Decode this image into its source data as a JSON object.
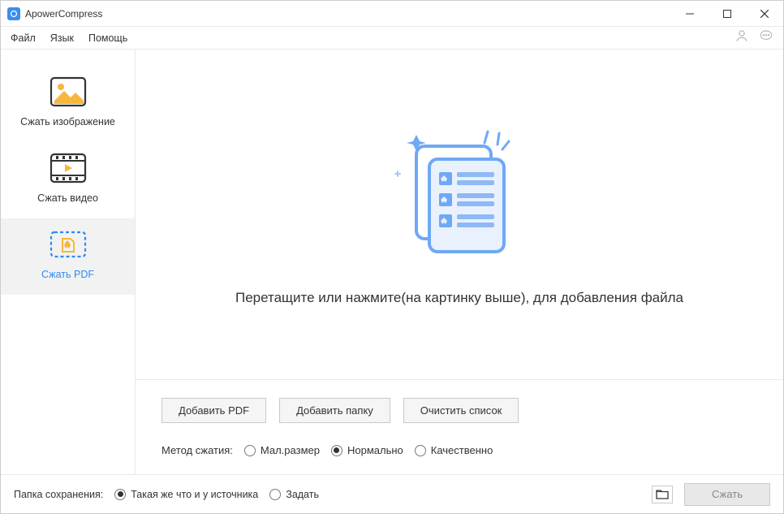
{
  "title": "ApowerCompress",
  "menu": {
    "file": "Файл",
    "lang": "Язык",
    "help": "Помощь"
  },
  "sidebar": {
    "image": "Сжать изображение",
    "video": "Сжать видео",
    "pdf": "Сжать PDF"
  },
  "dropzone": {
    "hint": "Перетащите или нажмите(на картинку выше), для добавления файла"
  },
  "buttons": {
    "add_pdf": "Добавить PDF",
    "add_folder": "Добавить папку",
    "clear_list": "Очистить список"
  },
  "method": {
    "label": "Метод сжатия:",
    "small": "Мал.размер",
    "normal": "Нормально",
    "quality": "Качественно"
  },
  "footer": {
    "save_label": "Папка сохранения:",
    "same_source": "Такая же что и у источника",
    "set": "Задать",
    "compress": "Сжать"
  }
}
